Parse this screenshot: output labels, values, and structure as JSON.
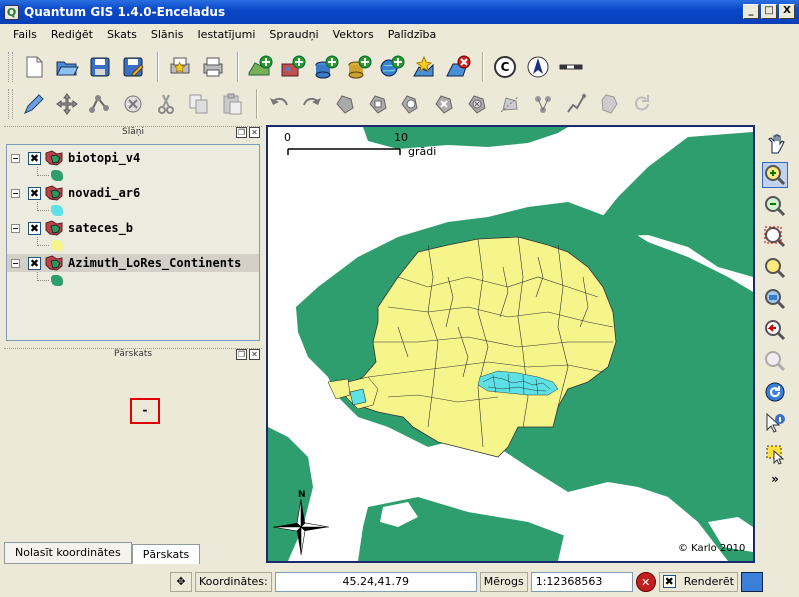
{
  "window": {
    "title": "Quantum GIS 1.4.0-Enceladus",
    "buttons": [
      "_",
      "□",
      "X"
    ]
  },
  "menu": [
    "Fails",
    "Rediģēt",
    "Skats",
    "Slānis",
    "Iestatījumi",
    "Spraudņi",
    "Vektors",
    "Palīdzība"
  ],
  "toolbar1": [
    "new-project-icon",
    "open-project-icon",
    "save-project-icon",
    "save-as-icon",
    "new-print-composer-icon",
    "print-icon",
    "add-vector-layer-icon",
    "add-raster-layer-icon",
    "add-postgis-layer-icon",
    "add-spatialite-layer-icon",
    "add-wms-layer-icon",
    "new-vector-layer-icon",
    "remove-layer-icon",
    "copyright-label-icon",
    "north-arrow-icon",
    "scale-bar-icon"
  ],
  "toolbar2": [
    "toggle-editing-icon",
    "move-feature-icon",
    "node-tool-icon",
    "delete-selected-icon",
    "cut-features-icon",
    "copy-features-icon",
    "paste-features-icon",
    "undo-icon",
    "redo-icon",
    "simplify-feature-icon",
    "add-ring-icon",
    "add-island-icon",
    "delete-ring-icon",
    "delete-part-icon",
    "reshape-features-icon",
    "split-features-icon",
    "merge-features-icon",
    "rotate-icon"
  ],
  "layers_panel": {
    "title": "Slāņi",
    "layers": [
      {
        "name": "biotopi_v4",
        "checked": "✖",
        "swatch": "#2e9e6e",
        "selected": false
      },
      {
        "name": "novadi_ar6",
        "checked": "✖",
        "swatch": "#5de0e6",
        "selected": false
      },
      {
        "name": "sateces_b",
        "checked": "✖",
        "swatch": "#f5f58c",
        "selected": false
      },
      {
        "name": "Azimuth_LoRes_Continents",
        "checked": "✖",
        "swatch": "#2e9e6e",
        "selected": true
      }
    ]
  },
  "overview_panel": {
    "title": "Pārskats",
    "marker": "-"
  },
  "bottom_tabs": [
    "Nolasīt koordinātes",
    "Pārskats"
  ],
  "map": {
    "scalebar_start": "0",
    "scalebar_end": "10",
    "scalebar_unit": "grādi",
    "north_label": "N",
    "copyright": "© Karlo 2010",
    "colors": {
      "land": "#2e9e6e",
      "fill": "#f5f58c",
      "detail": "#5de0e6",
      "sea": "#ffffff"
    }
  },
  "right_toolbar": [
    "pan-icon",
    "zoom-in-icon",
    "zoom-out-icon",
    "zoom-full-icon",
    "zoom-to-selection-icon",
    "zoom-to-layer-icon",
    "zoom-last-icon",
    "zoom-next-icon",
    "refresh-icon",
    "identify-icon",
    "select-features-icon",
    "more-chevron-icon"
  ],
  "statusbar": {
    "coords_label": "Koordinātes:",
    "coords_value": "45.24,41.79",
    "scale_label": "Mērogs",
    "scale_value": "1:12368563",
    "render_label": "Renderēt"
  }
}
